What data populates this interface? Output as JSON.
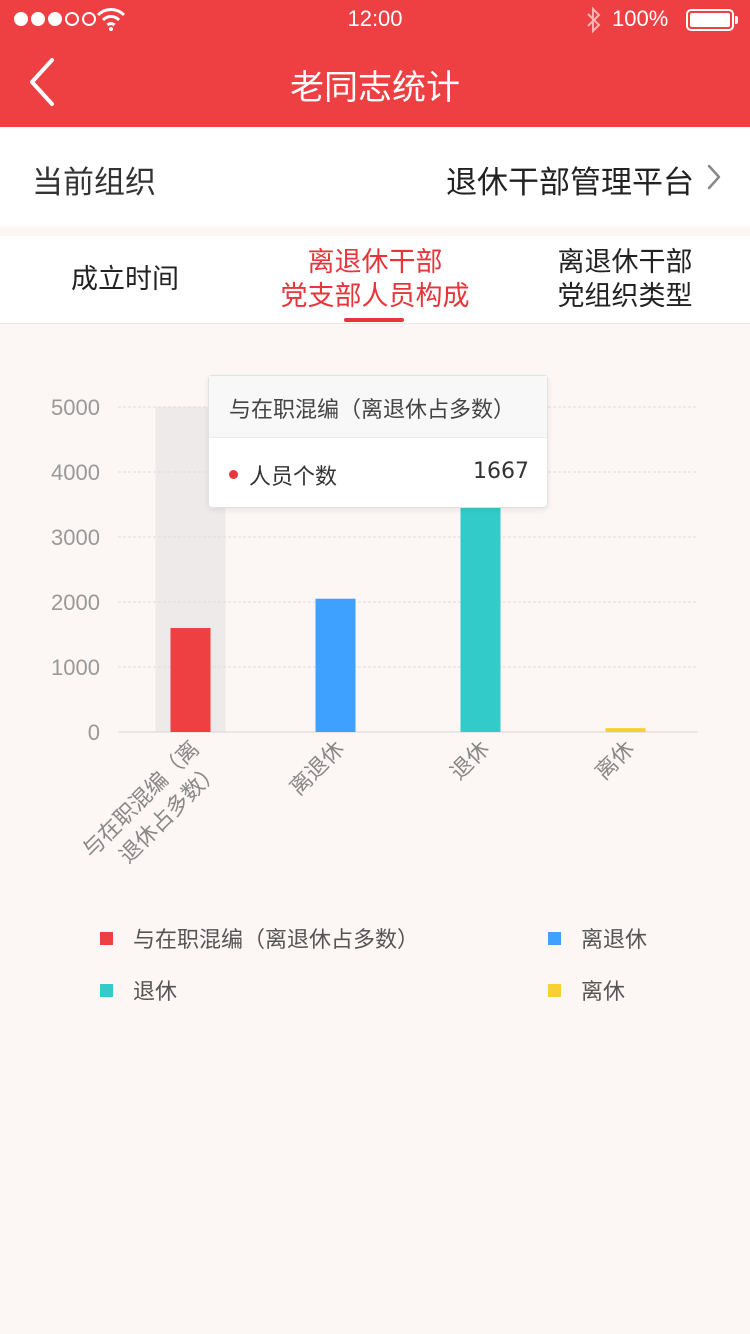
{
  "status": {
    "time": "12:00",
    "battery": "100%"
  },
  "nav": {
    "title": "老同志统计"
  },
  "org": {
    "label": "当前组织",
    "value": "退休干部管理平台"
  },
  "tabs": [
    {
      "line1": "成立时间",
      "line2": ""
    },
    {
      "line1": "离退休干部",
      "line2": "党支部人员构成"
    },
    {
      "line1": "离退休干部",
      "line2": "党组织类型"
    }
  ],
  "tooltip": {
    "title": "与在职混编（离退休占多数）",
    "series": "人员个数",
    "value": "1667"
  },
  "chart_data": {
    "type": "bar",
    "categories": [
      "与在职混编（离退休占多数）",
      "离退休",
      "退休",
      "离休"
    ],
    "series": [
      {
        "name": "人员个数",
        "values": [
          1600,
          2050,
          3450,
          60
        ]
      }
    ],
    "colors": [
      "#ee3f42",
      "#3ea0ff",
      "#33cbc9",
      "#f9d031"
    ],
    "ylim": [
      0,
      5000
    ],
    "yticks": [
      "0",
      "1000",
      "2000",
      "3000",
      "4000",
      "5000"
    ],
    "highlight": 0,
    "legend": [
      "与在职混编（离退休占多数）",
      "离退休",
      "退休",
      "离休"
    ],
    "legend_position": "bottom",
    "grid": true
  }
}
